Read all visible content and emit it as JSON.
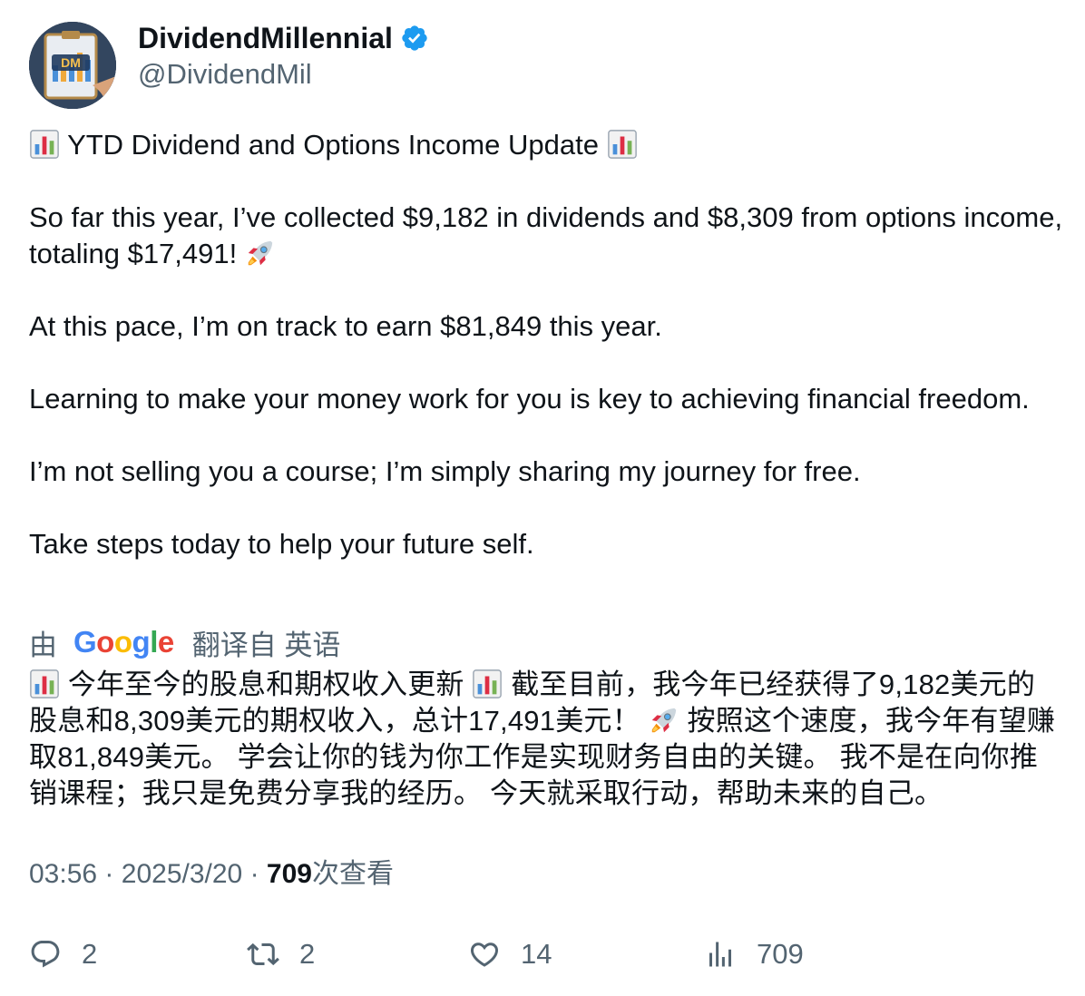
{
  "author": {
    "name": "DividendMillennial",
    "handle": "@DividendMil",
    "avatar_text": "DM",
    "verified": true,
    "verified_color": "#1d9bf0"
  },
  "tweet": {
    "paragraphs": [
      {
        "lead_emoji": "bar-chart-emoji",
        "text": "YTD Dividend and Options Income Update",
        "trail_emoji": "bar-chart-emoji"
      },
      {
        "text": "So far this year, I’ve collected $9,182 in dividends and $8,309 from options income, totaling $17,491!",
        "trail_emoji": "rocket-emoji"
      },
      {
        "text": "At this pace, I’m on track to earn $81,849 this year."
      },
      {
        "text": "Learning to make your money work for you is key to achieving financial freedom."
      },
      {
        "text": "I’m not selling you a course; I’m simply sharing my journey for free."
      },
      {
        "text": "Take steps today to help your future self."
      }
    ]
  },
  "translation": {
    "by_prefix": "由",
    "provider": "Google",
    "source_label": "翻译自 英语",
    "segments": [
      "今年至今的股息和期权收入更新",
      "截至目前，我今年已经获得了9,182美元的股息和8,309美元的期权收入，总计17,491美元！",
      "按照这个速度，我今年有望赚取81,849美元。 学会让你的钱为你工作是实现财务自由的关键。 我不是在向你推销课程；我只是免费分享我的经历。 今天就采取行动，帮助未来的自己。"
    ]
  },
  "meta": {
    "time": "03:56",
    "separator": "·",
    "date": "2025/3/20",
    "views_count": "709",
    "views_label": "次查看"
  },
  "actions": {
    "replies": "2",
    "reposts": "2",
    "likes": "14",
    "views": "709"
  }
}
